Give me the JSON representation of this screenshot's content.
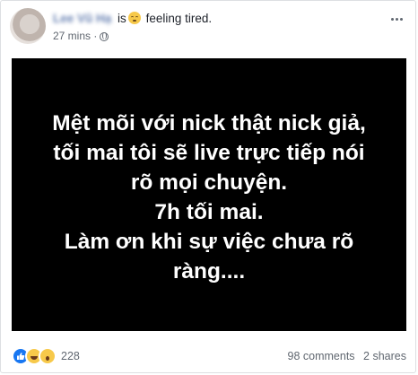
{
  "header": {
    "user_name": "Lee Vũ Hạ",
    "verb": "is",
    "feeling": "feeling tired.",
    "time": "27 mins",
    "privacy_icon": "globe-icon",
    "more_icon": "more-options-icon"
  },
  "post": {
    "lines": [
      "Mệt mõi với nick thật nick giả,",
      "tối mai tôi sẽ live trực tiếp nói",
      "rõ mọi chuyện.",
      "7h tối mai.",
      "Làm ơn khi sự việc chưa rõ",
      "ràng...."
    ]
  },
  "footer": {
    "reaction_icons": [
      "like-icon",
      "haha-icon",
      "wow-icon"
    ],
    "reaction_count": "228",
    "comments": "98 comments",
    "shares": "2 shares"
  },
  "colors": {
    "link": "#365899",
    "meta_text": "#606770",
    "post_bg": "#000000",
    "post_text": "#ffffff",
    "like_blue": "#1877f2"
  }
}
